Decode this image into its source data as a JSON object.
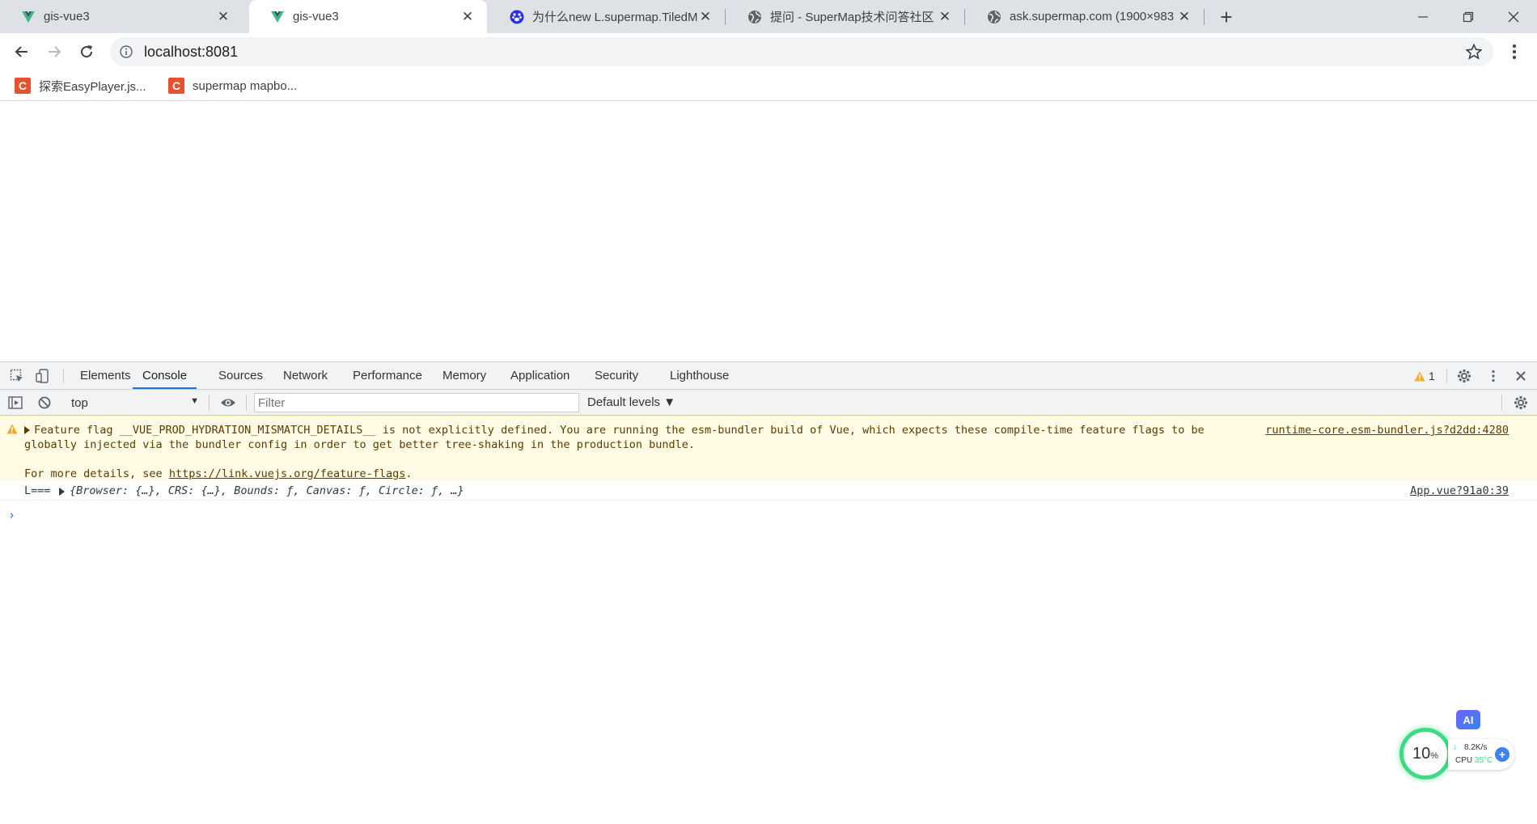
{
  "tabs": [
    {
      "title": "gis-vue3",
      "favicon": "vue-icon",
      "active": false
    },
    {
      "title": "gis-vue3",
      "favicon": "vue-icon",
      "active": true
    },
    {
      "title": "为什么new L.supermap.TiledM",
      "favicon": "baidu-paw-icon",
      "active": false
    },
    {
      "title": "提问 - SuperMap技术问答社区",
      "favicon": "globe-icon",
      "active": false
    },
    {
      "title": "ask.supermap.com (1900×983",
      "favicon": "globe-icon",
      "active": false
    }
  ],
  "toolbar": {
    "url": "localhost:8081"
  },
  "bookmarks": [
    {
      "label": "探索EasyPlayer.js...",
      "icon_letter": "C"
    },
    {
      "label": "supermap mapbo...",
      "icon_letter": "C"
    }
  ],
  "devtools": {
    "tabs": [
      "Elements",
      "Console",
      "Sources",
      "Network",
      "Performance",
      "Memory",
      "Application",
      "Security",
      "Lighthouse"
    ],
    "active_tab": "Console",
    "warning_count": "1",
    "context": "top",
    "filter_placeholder": "Filter",
    "levels_label": "Default levels ▼",
    "messages": {
      "warn_line1": "Feature flag __VUE_PROD_HYDRATION_MISMATCH_DETAILS__ is not explicitly defined. You are running the esm-bundler build of Vue, which expects these compile-time feature flags to be",
      "warn_line2": "globally injected via the bundler config in order to get better tree-shaking in the production bundle.",
      "warn_line3_prefix": "For more details, see ",
      "warn_link": "https://link.vuejs.org/feature-flags",
      "warn_line3_suffix": ".",
      "warn_source": "runtime-core.esm-bundler.js?d2dd:4280",
      "log_prefix": "L===",
      "log_object": "{Browser: {…}, CRS: {…}, Bounds: ƒ, Canvas: ƒ, Circle: ƒ, …}",
      "log_source": "App.vue?91a0:39",
      "prompt": "›"
    }
  },
  "widget": {
    "ai_label": "AI",
    "percent": "10",
    "percent_unit": "%",
    "speed": "8.2K/s",
    "cpu_label": "CPU",
    "cpu_temp": "35°C",
    "accent": "#3ddc84"
  },
  "colors": {
    "accent": "#1a73e8",
    "warn_bg": "#fffbe5",
    "tabstrip_bg": "#dee1e6"
  }
}
